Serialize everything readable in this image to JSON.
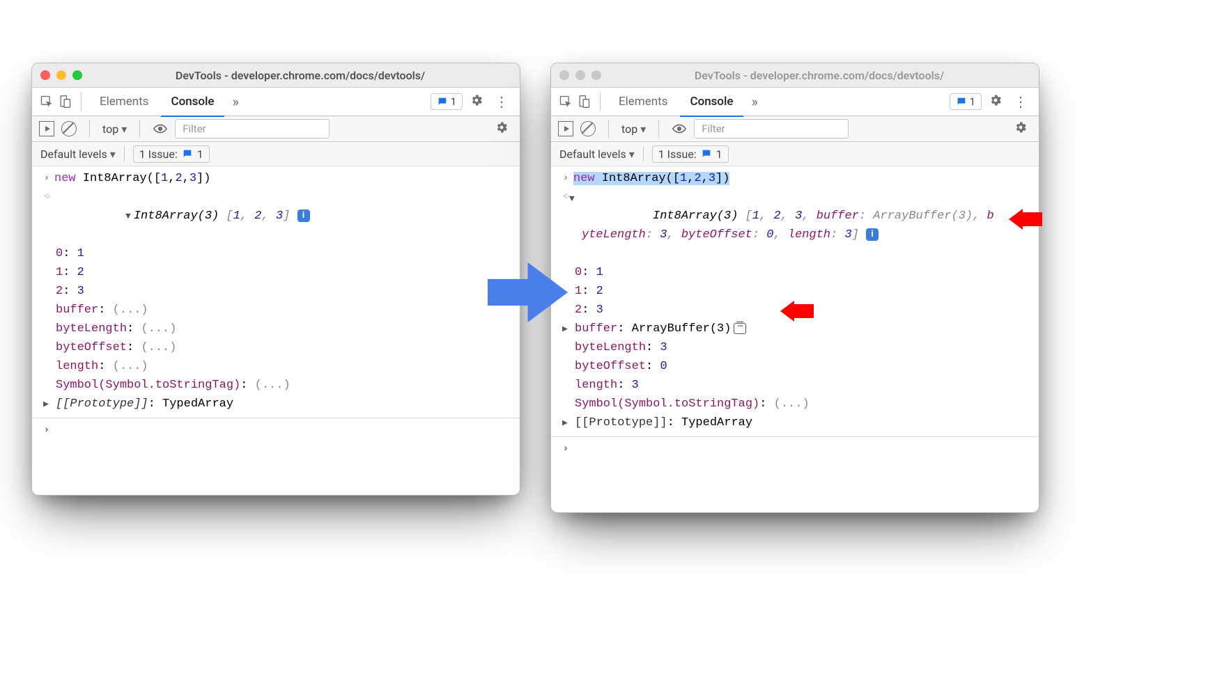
{
  "title": "DevTools - developer.chrome.com/docs/devtools/",
  "tabs": {
    "elements": "Elements",
    "console": "Console"
  },
  "issues_count": "1",
  "toolbar": {
    "context": "top",
    "filter_placeholder": "Filter"
  },
  "levels": "Default levels",
  "issue_label": "1 Issue:",
  "issue_badge": "1",
  "input_code": {
    "kw": "new",
    "rest": " Int8Array([",
    "n1": "1",
    "n2": "2",
    "n3": "3",
    "close": "])"
  },
  "left_panel": {
    "summary": {
      "type": "Int8Array(3)",
      "arr_open": " [",
      "v1": "1",
      "v2": "2",
      "v3": "3",
      "arr_close": "]"
    },
    "rows": [
      {
        "k": "0",
        "v": "1",
        "vnum": true
      },
      {
        "k": "1",
        "v": "2",
        "vnum": true
      },
      {
        "k": "2",
        "v": "3",
        "vnum": true
      },
      {
        "k": "buffer",
        "v": "(...)"
      },
      {
        "k": "byteLength",
        "v": "(...)"
      },
      {
        "k": "byteOffset",
        "v": "(...)"
      },
      {
        "k": "length",
        "v": "(...)"
      },
      {
        "k": "Symbol(Symbol.toStringTag)",
        "v": "(...)"
      }
    ],
    "proto": {
      "label": "[[Prototype]]",
      "val": "TypedArray"
    }
  },
  "right_panel": {
    "summary_line1_head": "Int8Array(3)",
    "summary_line1_rest": " [1, 2, 3, buffer: ArrayBuffer(3), b",
    "summary_line2": "yteLength: 3, byteOffset: 0, length: 3]",
    "rows": [
      {
        "k": "0",
        "v": "1",
        "vnum": true
      },
      {
        "k": "1",
        "v": "2",
        "vnum": true
      },
      {
        "k": "2",
        "v": "3",
        "vnum": true
      }
    ],
    "buffer": {
      "k": "buffer",
      "v": "ArrayBuffer(3)"
    },
    "rows2": [
      {
        "k": "byteLength",
        "v": "3",
        "vnum": true
      },
      {
        "k": "byteOffset",
        "v": "0",
        "vnum": true
      },
      {
        "k": "length",
        "v": "3",
        "vnum": true
      },
      {
        "k": "Symbol(Symbol.toStringTag)",
        "v": "(...)"
      }
    ],
    "proto": {
      "label": "[[Prototype]]",
      "val": "TypedArray"
    }
  }
}
